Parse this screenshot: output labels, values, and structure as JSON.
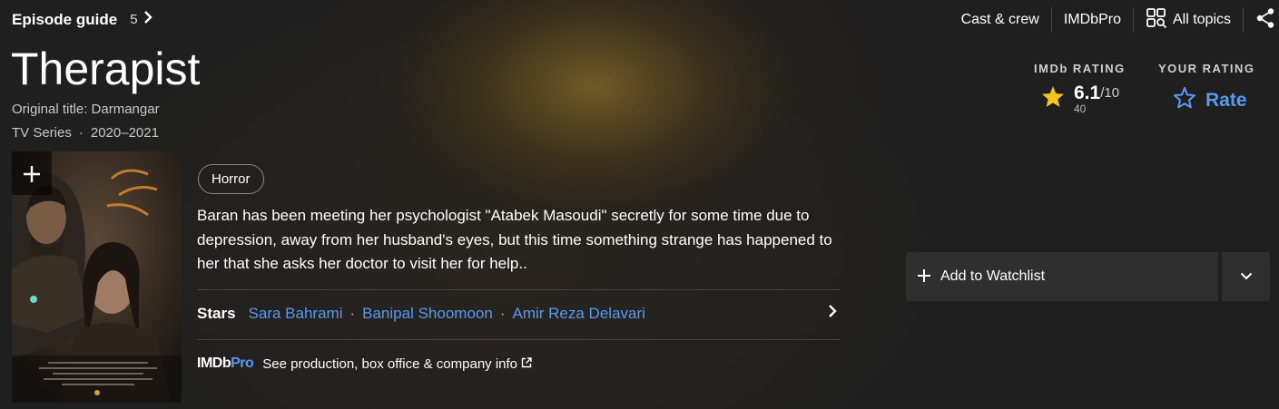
{
  "episode_guide": {
    "label": "Episode guide",
    "count": "5"
  },
  "topnav": {
    "cast": "Cast & crew",
    "imdbpro": "IMDbPro",
    "all_topics": "All topics"
  },
  "title": "Therapist",
  "original_title": "Original title: Darmangar",
  "meta": {
    "type": "TV Series",
    "years": "2020–2021"
  },
  "imdb_rating": {
    "header": "IMDb RATING",
    "score": "6.1",
    "out_of": "/10",
    "votes": "40"
  },
  "your_rating": {
    "header": "YOUR RATING",
    "label": "Rate"
  },
  "genre": "Horror",
  "plot": "Baran has been meeting her psychologist \"Atabek Masoudi\" secretly for some time due to depression, away from her husband's eyes, but this time something strange has happened to her that she asks her doctor to visit her for help..",
  "stars": {
    "label": "Stars",
    "names": [
      "Sara Bahrami",
      "Banipal Shoomoon",
      "Amir Reza Delavari"
    ]
  },
  "imdbpro_link": {
    "logo_main": "IMDb",
    "logo_pro": "Pro",
    "text": "See production, box office & company info"
  },
  "watchlist": {
    "label": "Add to Watchlist"
  },
  "colors": {
    "accent_blue": "#5799ef",
    "star_gold": "#f5c518",
    "background": "#1f1f1f"
  }
}
